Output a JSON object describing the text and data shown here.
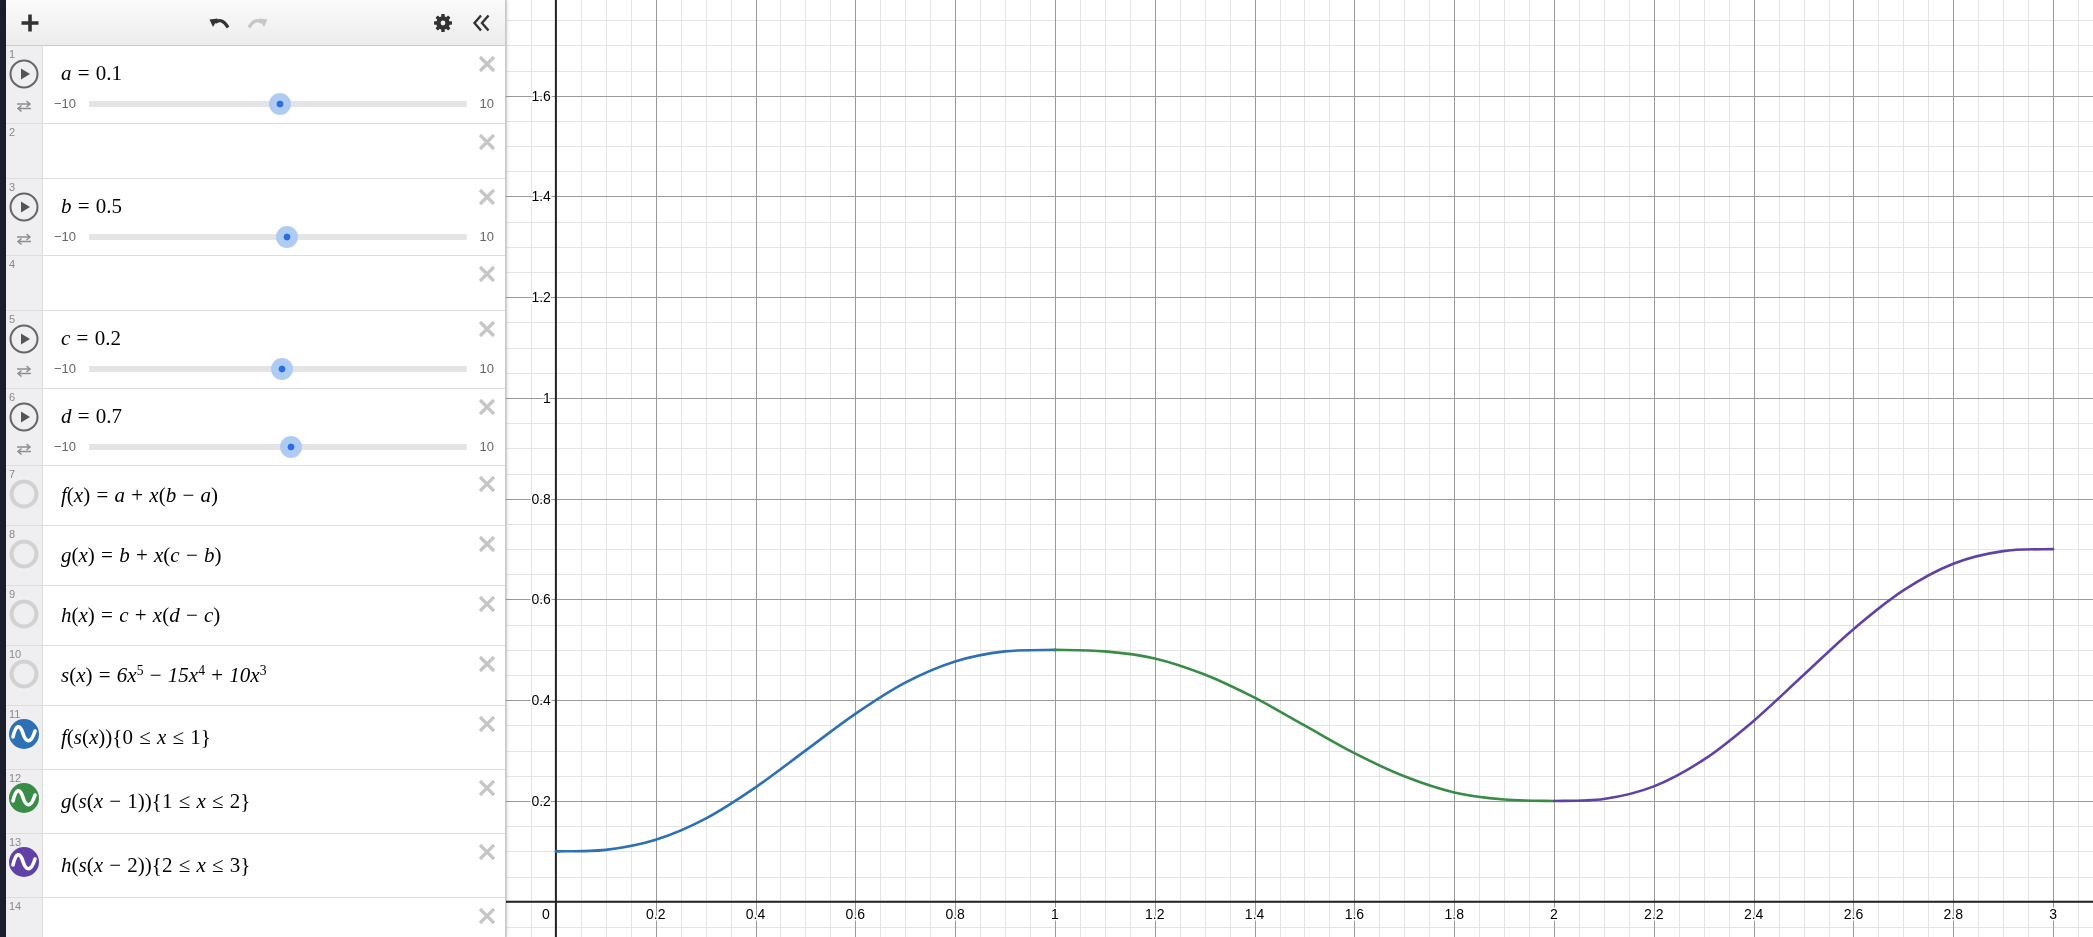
{
  "toolbar": {
    "undo": {
      "disabled": false
    },
    "redo": {
      "disabled": true
    }
  },
  "expressions": [
    {
      "number": "1",
      "kind": "slider",
      "math": "*a* = 0.1",
      "min": "−10",
      "max": "10",
      "level": 0.505
    },
    {
      "number": "2",
      "kind": "empty"
    },
    {
      "number": "3",
      "kind": "slider",
      "math": "*b* = 0.5",
      "min": "−10",
      "max": "10",
      "level": 0.525
    },
    {
      "number": "4",
      "kind": "empty"
    },
    {
      "number": "5",
      "kind": "slider",
      "math": "*c* = 0.2",
      "min": "−10",
      "max": "10",
      "level": 0.51
    },
    {
      "number": "6",
      "kind": "slider",
      "math": "*d* = 0.7",
      "min": "−10",
      "max": "10",
      "level": 0.535
    },
    {
      "number": "7",
      "kind": "expression",
      "math": "*f*(*x*) = *a* + *x*(*b* − *a*)",
      "visible": false
    },
    {
      "number": "8",
      "kind": "expression",
      "math": "*g*(*x*) = *b* + *x*(*c* − *b*)",
      "visible": false
    },
    {
      "number": "9",
      "kind": "expression",
      "math": "*h*(*x*) = *c* + *x*(*d* − *c*)",
      "visible": false
    },
    {
      "number": "10",
      "kind": "expression",
      "math": "*s*(*x*) = *6x*$^{5}$ − *15x*$^{4}$ + *10x*$^{3}$",
      "visible": false
    },
    {
      "number": "11",
      "kind": "expression",
      "math": "*f*(*s*(*x*)){0 ≤ *x* ≤ 1}",
      "visible": true,
      "color": "#2d70b3"
    },
    {
      "number": "12",
      "kind": "expression",
      "math": "*g*(*s*(*x* − 1)){1 ≤ *x* ≤ 2}",
      "visible": true,
      "color": "#388c46"
    },
    {
      "number": "13",
      "kind": "expression",
      "math": "*h*(*s*(*x* − 2)){2 ≤ *x* ≤ 3}",
      "visible": true,
      "color": "#6042a6"
    },
    {
      "number": "14",
      "kind": "empty"
    }
  ],
  "graph": {
    "origin_label": "0",
    "chart_data": {
      "type": "line",
      "grid": true,
      "x": [
        0,
        0.1,
        0.2,
        0.3,
        0.4,
        0.5,
        0.6,
        0.7,
        0.8,
        0.9,
        1,
        1.1,
        1.2,
        1.3,
        1.4,
        1.5,
        1.6,
        1.7,
        1.8,
        1.9,
        2,
        2.1,
        2.2,
        2.3,
        2.4,
        2.5,
        2.6,
        2.7,
        2.8,
        2.9,
        3
      ],
      "series": [
        {
          "color": "#2d70b3",
          "values": [
            0.1,
            0.103,
            0.123,
            0.165,
            0.227,
            0.3,
            0.373,
            0.435,
            0.477,
            0.497,
            0.5,
            null,
            null,
            null,
            null,
            null,
            null,
            null,
            null,
            null,
            null,
            null,
            null,
            null,
            null,
            null,
            null,
            null,
            null,
            null,
            null
          ]
        },
        {
          "color": "#388c46",
          "values": [
            null,
            null,
            null,
            null,
            null,
            null,
            null,
            null,
            null,
            null,
            0.5,
            0.497,
            0.483,
            0.451,
            0.405,
            0.35,
            0.295,
            0.249,
            0.217,
            0.203,
            0.2,
            null,
            null,
            null,
            null,
            null,
            null,
            null,
            null,
            null,
            null
          ]
        },
        {
          "color": "#6042a6",
          "values": [
            null,
            null,
            null,
            null,
            null,
            null,
            null,
            null,
            null,
            null,
            null,
            null,
            null,
            null,
            null,
            null,
            null,
            null,
            null,
            null,
            0.2,
            0.204,
            0.229,
            0.282,
            0.359,
            0.45,
            0.541,
            0.618,
            0.671,
            0.696,
            0.7
          ]
        }
      ],
      "xlim": [
        -0.1,
        3.08
      ],
      "ylim": [
        -0.07,
        1.79
      ],
      "xticks": [
        0.2,
        0.4,
        0.6,
        0.8,
        {
          "value": 1,
          "label": "1"
        },
        1.2,
        1.4,
        1.6,
        1.8,
        {
          "value": 2,
          "label": "2"
        },
        2.2,
        2.4,
        2.6,
        2.8,
        {
          "value": 3,
          "label": "3"
        }
      ],
      "yticks": [
        0.2,
        0.4,
        0.6,
        0.8,
        {
          "value": 1,
          "label": "1"
        },
        1.2,
        1.4,
        1.6
      ]
    }
  }
}
